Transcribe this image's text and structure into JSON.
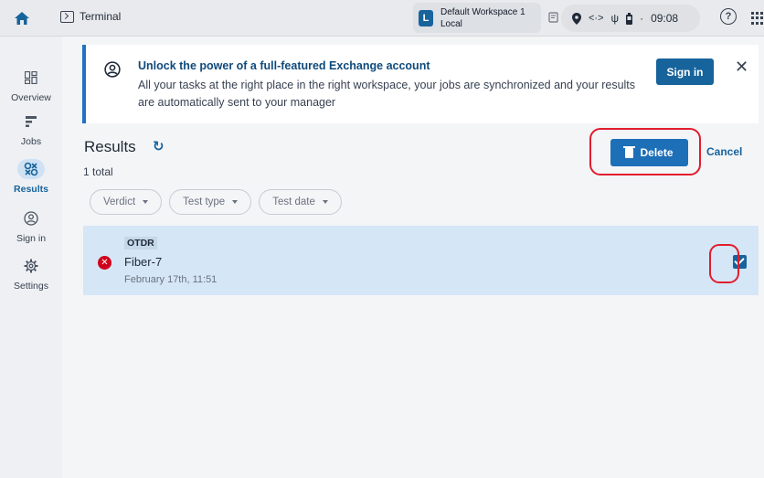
{
  "topbar": {
    "terminal_label": "Terminal",
    "workspace_badge": "L",
    "workspace_name": "Default Workspace 1",
    "workspace_sub": "Local",
    "time": "09:08",
    "help_glyph": "?"
  },
  "sidebar": {
    "items": [
      {
        "label": "Overview",
        "icon": "overview-icon"
      },
      {
        "label": "Jobs",
        "icon": "jobs-icon"
      },
      {
        "label": "Results",
        "icon": "results-icon",
        "active": true
      },
      {
        "label": "Sign in",
        "icon": "account-icon"
      },
      {
        "label": "Settings",
        "icon": "gear-icon"
      }
    ]
  },
  "banner": {
    "title": "Unlock the power of a full-featured Exchange account",
    "text": "All your tasks at the right place in the right workspace, your jobs are synchronized and your results are automatically sent to your manager",
    "signin_label": "Sign in",
    "close_glyph": "✕"
  },
  "results": {
    "title": "Results",
    "refresh_glyph": "↻",
    "total": "1 total",
    "delete_label": "Delete",
    "cancel_label": "Cancel",
    "filters": [
      "Verdict",
      "Test type",
      "Test date"
    ],
    "rows": [
      {
        "type": "OTDR",
        "verdict_glyph": "✕",
        "name": "Fiber-7",
        "date": "February 17th, 11:51",
        "checked": true
      }
    ]
  },
  "colors": {
    "accent": "#17639c",
    "highlight": "#e11d2e",
    "selected_row": "#d5e6f6"
  }
}
